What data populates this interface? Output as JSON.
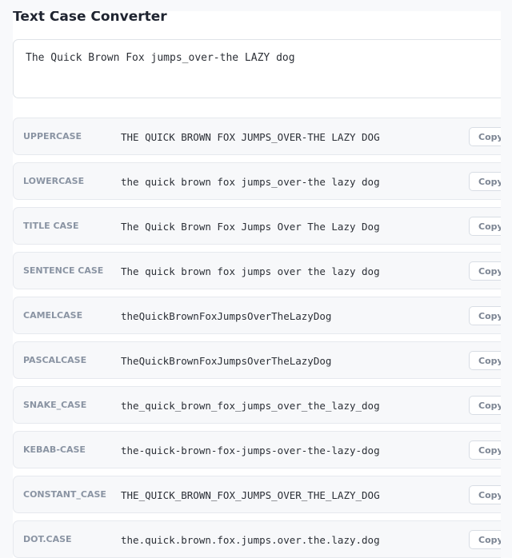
{
  "app": {
    "title": "Text Case Converter"
  },
  "input": {
    "value": "The Quick Brown Fox jumps_over-the LAZY dog"
  },
  "conversions": [
    {
      "label": "UPPERCASE",
      "value": "THE QUICK BROWN FOX JUMPS_OVER-THE LAZY DOG",
      "copy_label": "Copy"
    },
    {
      "label": "LOWERCASE",
      "value": "the quick brown fox jumps_over-the lazy dog",
      "copy_label": "Copy"
    },
    {
      "label": "TITLE CASE",
      "value": "The Quick Brown Fox Jumps Over The Lazy Dog",
      "copy_label": "Copy"
    },
    {
      "label": "SENTENCE CASE",
      "value": "The quick brown fox jumps over the lazy dog",
      "copy_label": "Copy"
    },
    {
      "label": "CAMELCASE",
      "value": "theQuickBrownFoxJumpsOverTheLazyDog",
      "copy_label": "Copy"
    },
    {
      "label": "PASCALCASE",
      "value": "TheQuickBrownFoxJumpsOverTheLazyDog",
      "copy_label": "Copy"
    },
    {
      "label": "SNAKE_CASE",
      "value": "the_quick_brown_fox_jumps_over_the_lazy_dog",
      "copy_label": "Copy"
    },
    {
      "label": "KEBAB-CASE",
      "value": "the-quick-brown-fox-jumps-over-the-lazy-dog",
      "copy_label": "Copy"
    },
    {
      "label": "CONSTANT_CASE",
      "value": "THE_QUICK_BROWN_FOX_JUMPS_OVER_THE_LAZY_DOG",
      "copy_label": "Copy"
    },
    {
      "label": "DOT.CASE",
      "value": "the.quick.brown.fox.jumps.over.the.lazy.dog",
      "copy_label": "Copy"
    }
  ]
}
